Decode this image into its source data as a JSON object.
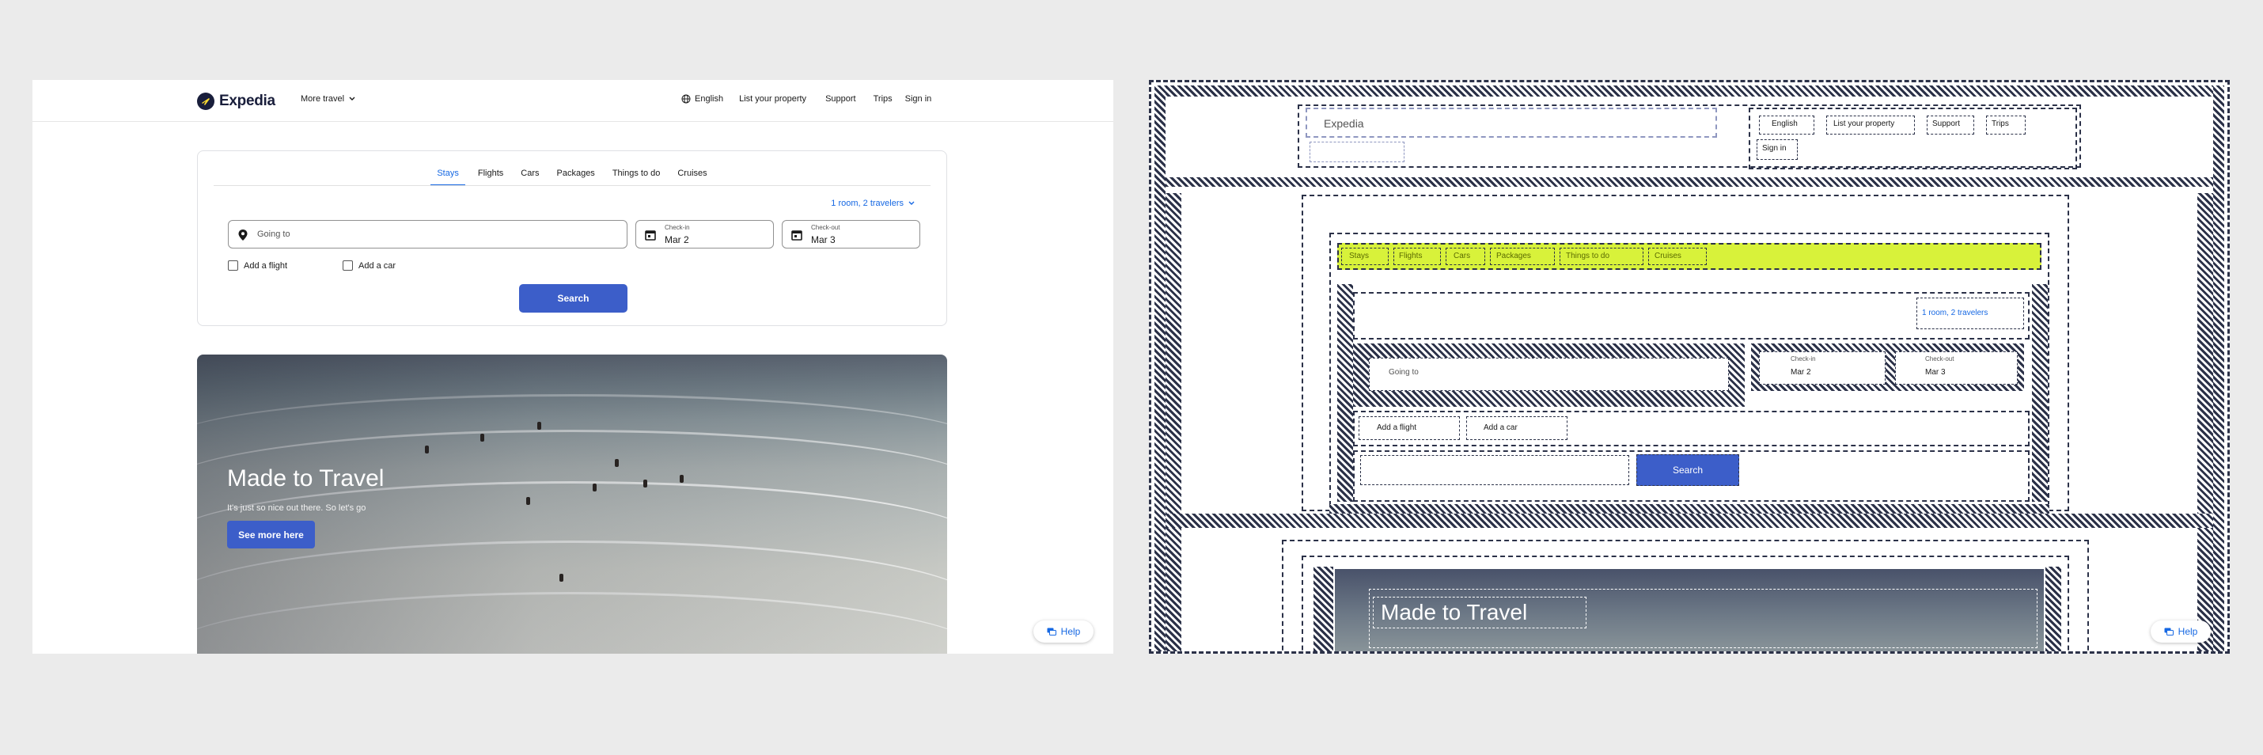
{
  "brand": {
    "name": "Expedia",
    "color": "#191e3b"
  },
  "colors": {
    "accent": "#1668e3",
    "button": "#3c5ec9",
    "lime_highlight": "#d8f23a"
  },
  "header": {
    "more_travel": "More travel",
    "language": "English",
    "list_property": "List your property",
    "support": "Support",
    "trips": "Trips",
    "sign_in": "Sign in"
  },
  "search": {
    "tabs": [
      "Stays",
      "Flights",
      "Cars",
      "Packages",
      "Things to do",
      "Cruises"
    ],
    "active_tab": "Stays",
    "travelers": "1 room, 2 travelers",
    "going_to_placeholder": "Going to",
    "check_in_label": "Check-in",
    "check_in_value": "Mar 2",
    "check_out_label": "Check-out",
    "check_out_value": "Mar 3",
    "add_flight": "Add a flight",
    "add_car": "Add a car",
    "button": "Search"
  },
  "hero": {
    "title": "Made to Travel",
    "subtitle": "It's just so nice out there. So let's go",
    "button": "See more here"
  },
  "help": {
    "label": "Help"
  },
  "overlay": {
    "logo": "Expedia",
    "language": "English",
    "list_property": "List your property",
    "support": "Support",
    "trips": "Trips",
    "sign_in": "Sign in",
    "tabs": [
      "Stays",
      "Flights",
      "Cars",
      "Packages",
      "Things to do",
      "Cruises"
    ],
    "travelers": "1 room, 2 travelers",
    "going_to": "Going to",
    "check_in_label": "Check-in",
    "check_in_value": "Mar 2",
    "check_out_label": "Check-out",
    "check_out_value": "Mar 3",
    "add_flight": "Add a flight",
    "add_car": "Add a car",
    "search": "Search",
    "hero_title": "Made to Travel",
    "help": "Help"
  }
}
